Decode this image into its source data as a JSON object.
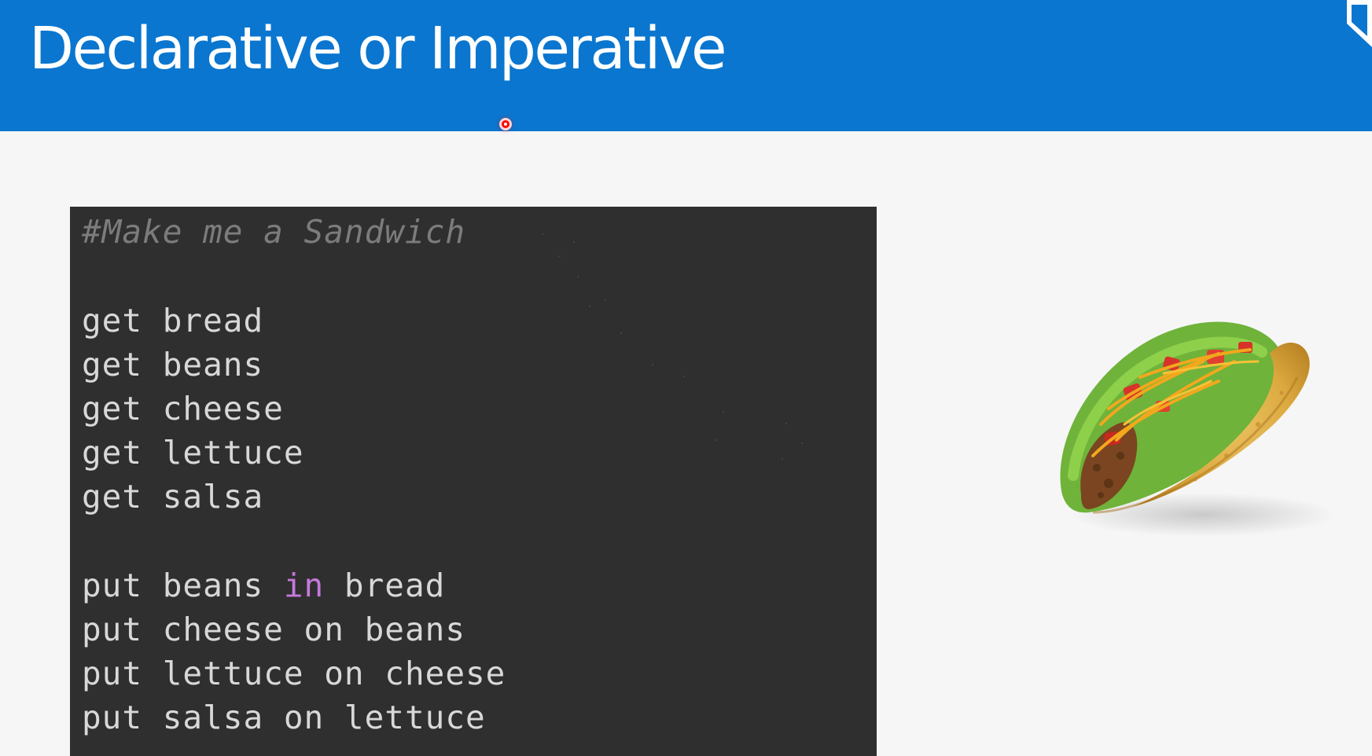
{
  "slide": {
    "title": "Declarative or Imperative",
    "colors": {
      "header_bg": "#0a76cf",
      "title_text": "#ffffff",
      "code_bg": "#2f2f2f",
      "code_text": "#d8d8d8",
      "comment_text": "#7c7c7c",
      "keyword_text": "#c678dd",
      "cursor_dot": "#ff0000"
    }
  },
  "code": {
    "comment": "#Make me a Sandwich",
    "get_lines": [
      "get bread",
      "get beans",
      "get cheese",
      "get lettuce",
      "get salsa"
    ],
    "put_line_1": {
      "before": "put beans ",
      "keyword": "in",
      "after": " bread"
    },
    "put_lines": [
      "put cheese on beans",
      "put lettuce on cheese",
      "put salsa on lettuce"
    ]
  },
  "image": {
    "icon": "taco-image"
  }
}
